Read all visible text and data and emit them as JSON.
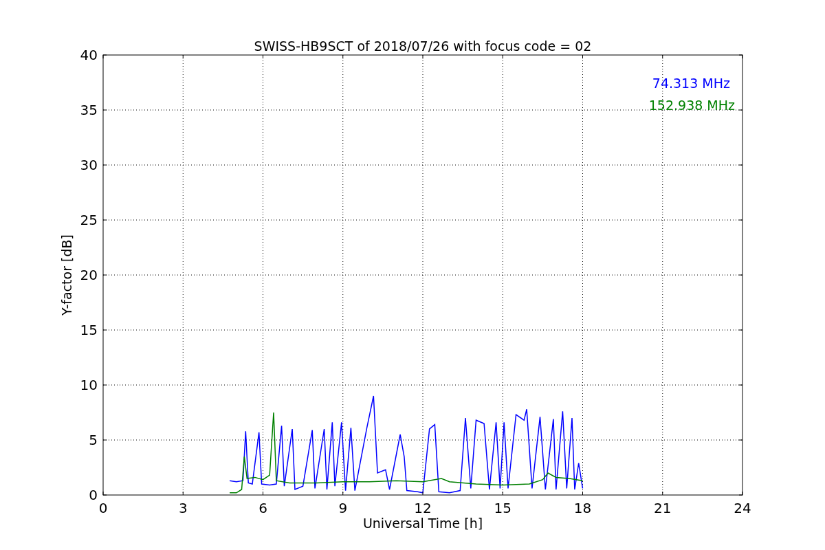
{
  "chart_data": {
    "type": "line",
    "title": "SWISS-HB9SCT of 2018/07/26 with focus code = 02",
    "xlabel": "Universal Time [h]",
    "ylabel": "Y-factor [dB]",
    "xlim": [
      0,
      24
    ],
    "ylim": [
      0,
      40
    ],
    "xticks": [
      0,
      3,
      6,
      9,
      12,
      15,
      18,
      21,
      24
    ],
    "yticks": [
      0,
      5,
      10,
      15,
      20,
      25,
      30,
      35,
      40
    ],
    "grid": true,
    "series": [
      {
        "name": "74.313 MHz",
        "color": "#0000ff",
        "x": [
          4.75,
          5.0,
          5.25,
          5.35,
          5.45,
          5.6,
          5.85,
          5.95,
          6.25,
          6.5,
          6.7,
          6.8,
          7.1,
          7.2,
          7.5,
          7.85,
          7.95,
          8.3,
          8.4,
          8.6,
          8.7,
          8.95,
          9.1,
          9.3,
          9.45,
          9.9,
          10.15,
          10.3,
          10.6,
          10.75,
          11.15,
          11.3,
          11.4,
          11.8,
          12.0,
          12.25,
          12.45,
          12.6,
          13.0,
          13.4,
          13.6,
          13.8,
          14.0,
          14.3,
          14.5,
          14.75,
          14.9,
          15.05,
          15.2,
          15.5,
          15.8,
          15.9,
          16.1,
          16.4,
          16.6,
          16.9,
          17.0,
          17.25,
          17.4,
          17.6,
          17.7,
          17.85,
          18.0
        ],
        "values": [
          1.3,
          1.2,
          1.3,
          5.8,
          1.1,
          1.0,
          5.7,
          1.0,
          0.9,
          1.0,
          6.3,
          0.8,
          6.0,
          0.5,
          0.8,
          5.9,
          0.6,
          6.0,
          0.5,
          6.6,
          0.8,
          6.6,
          0.4,
          6.1,
          0.4,
          6.1,
          9.0,
          2.0,
          2.3,
          0.5,
          5.5,
          3.5,
          0.4,
          0.3,
          0.2,
          6.0,
          6.4,
          0.3,
          0.2,
          0.4,
          7.0,
          0.6,
          6.8,
          6.5,
          0.5,
          6.6,
          0.6,
          6.6,
          0.6,
          7.3,
          6.8,
          7.8,
          0.6,
          7.1,
          0.5,
          6.9,
          0.5,
          7.6,
          0.6,
          7.0,
          0.5,
          2.9,
          0.6
        ]
      },
      {
        "name": "152.938 MHz",
        "color": "#008000",
        "x": [
          4.75,
          5.0,
          5.2,
          5.3,
          5.4,
          5.7,
          6.0,
          6.25,
          6.4,
          6.5,
          7.0,
          8.0,
          9.0,
          10.0,
          11.0,
          12.0,
          12.7,
          13.0,
          14.0,
          15.0,
          16.0,
          16.5,
          16.7,
          17.0,
          17.5,
          18.0
        ],
        "values": [
          0.2,
          0.2,
          0.5,
          3.5,
          1.5,
          1.6,
          1.4,
          1.8,
          7.5,
          1.3,
          1.1,
          1.1,
          1.2,
          1.2,
          1.3,
          1.2,
          1.5,
          1.2,
          1.0,
          0.9,
          1.0,
          1.4,
          2.0,
          1.6,
          1.5,
          1.3
        ]
      }
    ]
  }
}
